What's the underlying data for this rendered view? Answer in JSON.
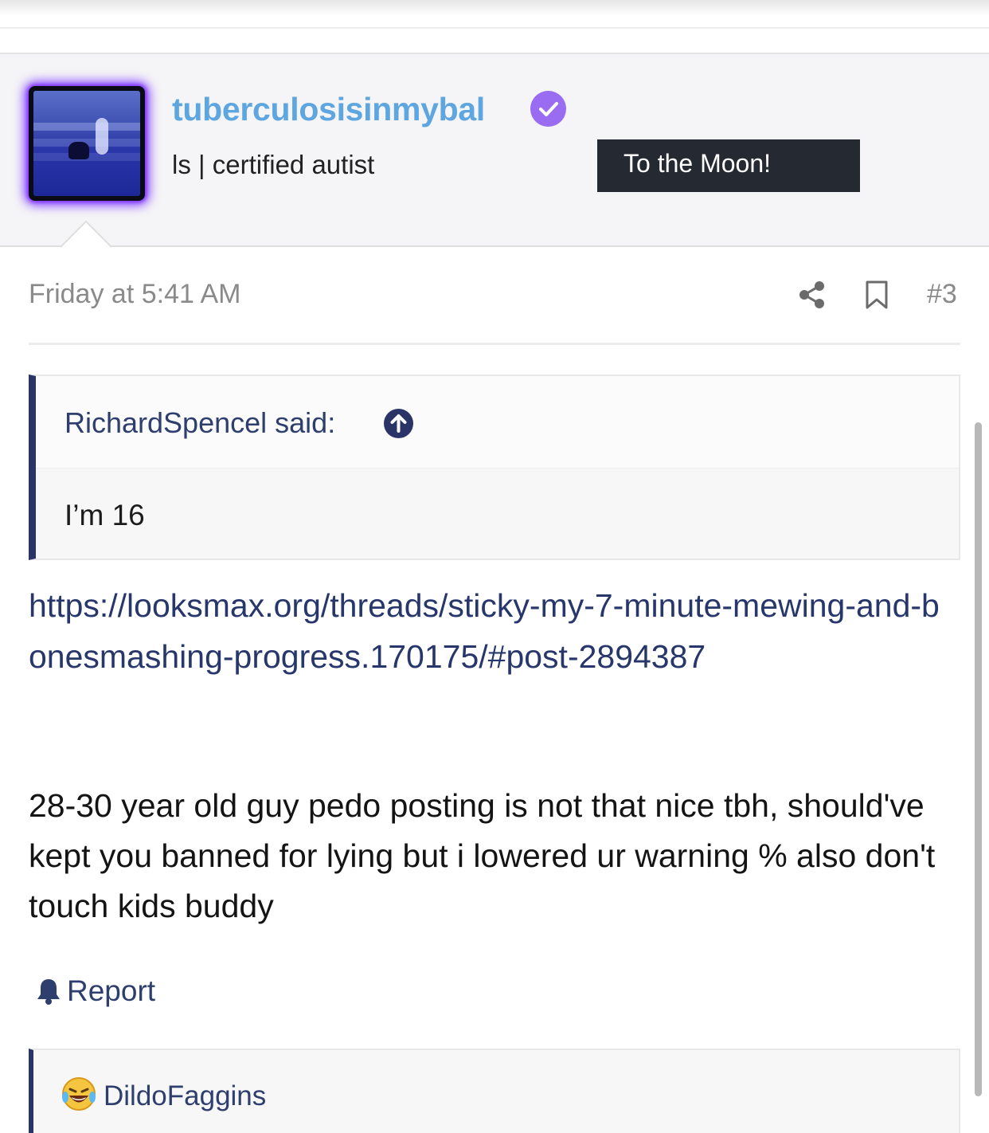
{
  "user": {
    "username": "tuberculosisinmybal",
    "title": "ls | certified autist",
    "banner": "To the Moon!",
    "verified_icon": "verified-check-icon"
  },
  "post": {
    "date": "Friday at 5:41 AM",
    "number": "#3",
    "quote": {
      "author_line": "RichardSpencel said:",
      "body": "I’m 16"
    },
    "link": "https://looksmax.org/threads/sticky-my-7-minute-mewing-and-bonesmashing-progress.170175/#post-2894387",
    "text": "28-30 year old guy pedo posting is not that nice tbh, should've kept you banned for lying but i lowered ur warning % also don't touch kids buddy",
    "report_label": "Report"
  },
  "reactions": {
    "emoji": "laughing-crying-emoji",
    "users": "DildoFaggins"
  },
  "colors": {
    "username": "#5ea6e0",
    "verified": "#9a6cf2",
    "avatar_glow": "#7b33ff",
    "accent": "#2b3466",
    "link": "#27376b",
    "banner_bg": "#252932"
  }
}
